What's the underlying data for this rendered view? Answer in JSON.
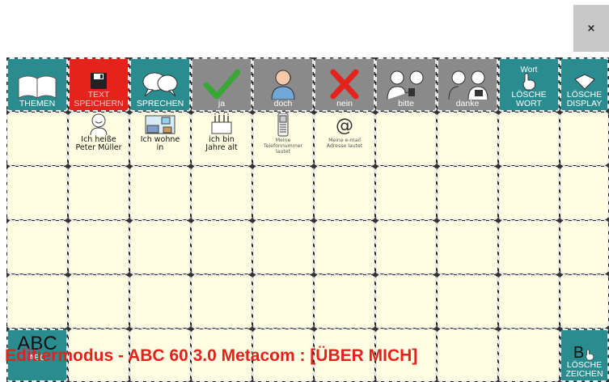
{
  "window": {
    "close_label": "×"
  },
  "toolbar": {
    "themen": "THEMEN",
    "text_speichern": "TEXT\nSPEICHERN",
    "sprechen": "SPRECHEN",
    "ja": "ja",
    "doch": "doch",
    "nein": "nein",
    "bitte": "bitte",
    "danke": "danke",
    "loesche_wort_top": "Wort",
    "loesche_wort": "LÖSCHE\nWORT",
    "loesche_display": "LÖSCHE\nDISPLAY"
  },
  "cells": {
    "ich_heisse": "Ich heiße\nPeter Müller",
    "ich_wohne": "Ich wohne\nin",
    "ich_bin": "ich bin\nJahre alt",
    "telefon": "Meine\nTelefonnummer\nlautet",
    "email": "Meine e-mail\nAdresse lautet",
    "email_symbol": "@"
  },
  "bottom": {
    "abc_big": "ABC",
    "abc_small": "ABC",
    "loesche_zeichen_symbol": "B",
    "loesche_zeichen": "LÖSCHE\nZEICHEN"
  },
  "status": {
    "text": "Editiermodus - ABC 60 3.0 Metacom : [ÜBER MICH]"
  },
  "colors": {
    "teal": "#2b8c8f",
    "gray": "#8a8a8a",
    "red": "#e3231c",
    "cream": "#fffde2",
    "status_red": "#e5211d"
  }
}
